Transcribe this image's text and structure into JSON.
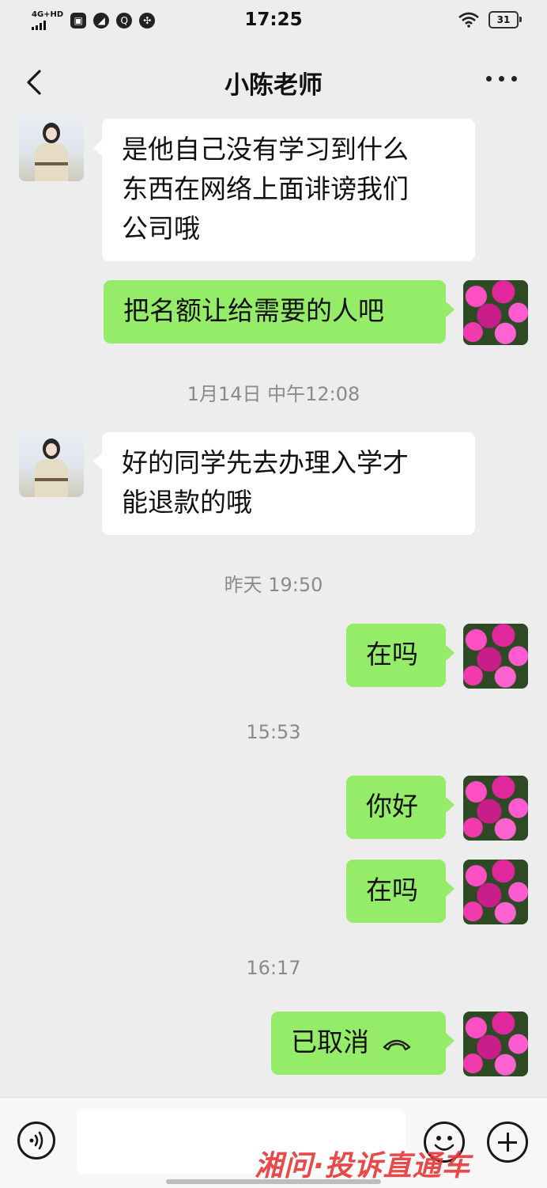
{
  "status_bar": {
    "time": "17:25",
    "network": "4G+HD",
    "battery": "31"
  },
  "header": {
    "title": "小陈老师"
  },
  "messages": [
    {
      "sender": "contact",
      "text_lines": [
        "是他自己没有学习到什么",
        "东西在网络上面诽谤我们",
        "公司哦"
      ]
    },
    {
      "sender": "me",
      "text": "把名额让给需要的人吧"
    },
    {
      "type": "timestamp",
      "text": "1月14日 中午12:08"
    },
    {
      "sender": "contact",
      "text_lines": [
        "好的同学先去办理入学才",
        "能退款的哦"
      ]
    },
    {
      "type": "timestamp",
      "text": "昨天 19:50"
    },
    {
      "sender": "me",
      "text": "在吗"
    },
    {
      "type": "timestamp",
      "text": "15:53"
    },
    {
      "sender": "me",
      "text": "你好"
    },
    {
      "sender": "me",
      "text": "在吗"
    },
    {
      "type": "timestamp",
      "text": "16:17"
    },
    {
      "sender": "me",
      "text": "已取消",
      "icon": "phone-hangup-icon"
    }
  ],
  "watermark": "湘问·投诉直通车",
  "icons": {
    "back": "back-arrow-icon",
    "more": "more-dots-icon",
    "voice": "voice-icon",
    "emoji": "emoji-icon",
    "plus": "plus-icon"
  },
  "colors": {
    "background": "#ededed",
    "incoming_bubble": "#ffffff",
    "outgoing_bubble": "#95ec69",
    "watermark": "#e83a3a"
  }
}
